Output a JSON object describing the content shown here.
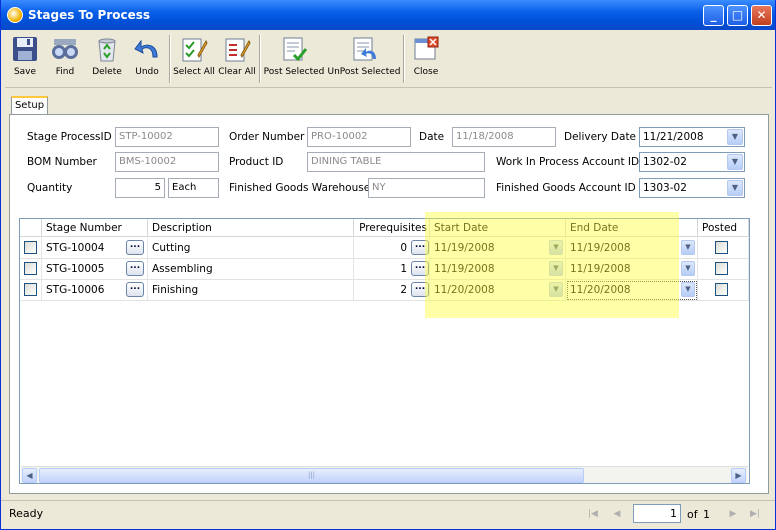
{
  "window": {
    "title": "Stages To Process"
  },
  "toolbar": {
    "save": "Save",
    "find": "Find",
    "delete": "Delete",
    "undo": "Undo",
    "select_all": "Select All",
    "clear_all": "Clear All",
    "post_selected": "Post Selected",
    "unpost_selected": "UnPost Selected",
    "close": "Close"
  },
  "tabs": {
    "setup": "Setup"
  },
  "form": {
    "stage_process_id_label": "Stage ProcessID",
    "stage_process_id": "STP-10002",
    "order_number_label": "Order Number",
    "order_number": "PRO-10002",
    "date_label": "Date",
    "date": "11/18/2008",
    "delivery_date_label": "Delivery Date",
    "delivery_date": "11/21/2008",
    "bom_number_label": "BOM Number",
    "bom_number": "BMS-10002",
    "product_id_label": "Product ID",
    "product_id": "DINING TABLE",
    "wip_account_label": "Work In Process Account ID",
    "wip_account": "1302-02",
    "quantity_label": "Quantity",
    "quantity": "5",
    "uom": "Each",
    "fg_warehouse_label": "Finished Goods Warehouse",
    "fg_warehouse": "NY",
    "fg_account_label": "Finished Goods Account ID",
    "fg_account": "1303-02"
  },
  "grid": {
    "headers": {
      "stage_number": "Stage Number",
      "description": "Description",
      "prerequisites": "Prerequisites",
      "start_date": "Start Date",
      "end_date": "End Date",
      "posted": "Posted"
    },
    "rows": [
      {
        "stage_number": "STG-10004",
        "description": "Cutting",
        "prerequisites": "0",
        "start_date": "11/19/2008",
        "end_date": "11/19/2008"
      },
      {
        "stage_number": "STG-10005",
        "description": "Assembling",
        "prerequisites": "1",
        "start_date": "11/19/2008",
        "end_date": "11/19/2008"
      },
      {
        "stage_number": "STG-10006",
        "description": "Finishing",
        "prerequisites": "2",
        "start_date": "11/20/2008",
        "end_date": "11/20/2008"
      }
    ]
  },
  "status": {
    "text": "Ready",
    "page": "1",
    "of_label": "of",
    "total_pages": "1"
  }
}
